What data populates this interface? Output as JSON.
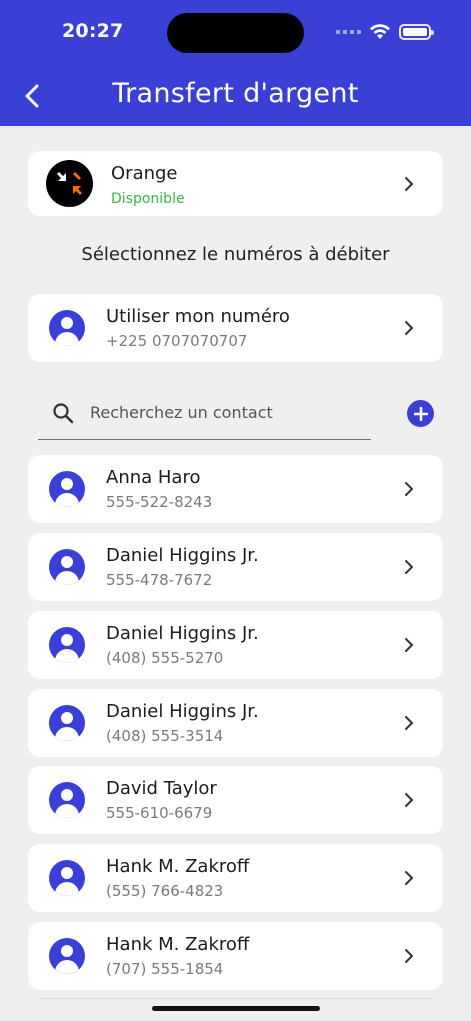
{
  "status_bar": {
    "time": "20:27"
  },
  "header": {
    "title": "Transfert d'argent"
  },
  "operator": {
    "name": "Orange",
    "status": "Disponible"
  },
  "section_label": "Sélectionnez le numéros à débiter",
  "own_number": {
    "label": "Utiliser mon numéro",
    "phone": "+225 0707070707"
  },
  "search": {
    "placeholder": "Recherchez un contact"
  },
  "contacts": [
    {
      "name": "Anna Haro",
      "phone": "555-522-8243"
    },
    {
      "name": "Daniel Higgins Jr.",
      "phone": "555-478-7672"
    },
    {
      "name": "Daniel Higgins Jr.",
      "phone": "(408) 555-5270"
    },
    {
      "name": "Daniel Higgins Jr.",
      "phone": "(408) 555-3514"
    },
    {
      "name": "David Taylor",
      "phone": "555-610-6679"
    },
    {
      "name": "Hank M. Zakroff",
      "phone": "(555) 766-4823"
    },
    {
      "name": "Hank M. Zakroff",
      "phone": "(707) 555-1854"
    }
  ],
  "colors": {
    "accent": "#3a3fd6",
    "available": "#3bb54a",
    "background": "#efefef"
  },
  "icons": [
    "back-chevron-icon",
    "search-icon",
    "add-icon",
    "chevron-right-icon",
    "user-icon",
    "wifi-icon",
    "battery-icon",
    "orange-logo-icon"
  ]
}
